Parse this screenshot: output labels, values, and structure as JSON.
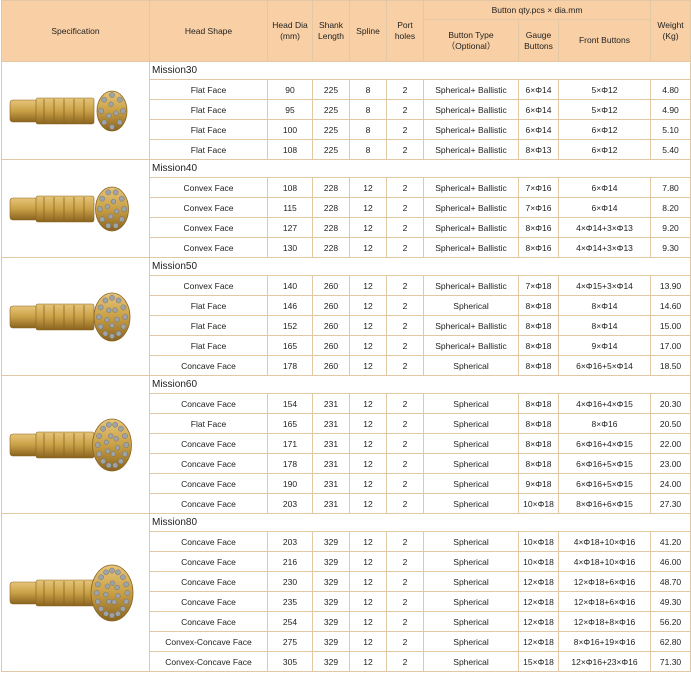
{
  "header": {
    "specification": "Specification",
    "head_shape": "Head Shape",
    "head_dia": "Head Dia (mm)",
    "shank_length": "Shank Length",
    "spline": "Spline",
    "port_holes": "Port holes",
    "button_group": "Button qty.pcs × dia.mm",
    "button_type": "Button Type",
    "button_type_optional": "（Optional）",
    "gauge_buttons": "Gauge Buttons",
    "front_buttons": "Front Buttons",
    "weight": "Weight (Kg)"
  },
  "groups": [
    {
      "name": "Mission30",
      "image": "dth-hammer-bit-flat-face",
      "rows": [
        {
          "shape": "Flat Face",
          "dia": "90",
          "shank": "225",
          "spline": "8",
          "ports": "2",
          "type": "Spherical+ Ballistic",
          "gauge": "6×Φ14",
          "front": "5×Φ12",
          "weight": "4.80"
        },
        {
          "shape": "Flat Face",
          "dia": "95",
          "shank": "225",
          "spline": "8",
          "ports": "2",
          "type": "Spherical+ Ballistic",
          "gauge": "6×Φ14",
          "front": "5×Φ12",
          "weight": "4.90"
        },
        {
          "shape": "Flat Face",
          "dia": "100",
          "shank": "225",
          "spline": "8",
          "ports": "2",
          "type": "Spherical+ Ballistic",
          "gauge": "6×Φ14",
          "front": "6×Φ12",
          "weight": "5.10"
        },
        {
          "shape": "Flat Face",
          "dia": "108",
          "shank": "225",
          "spline": "8",
          "ports": "2",
          "type": "Spherical+ Ballistic",
          "gauge": "8×Φ13",
          "front": "6×Φ12",
          "weight": "5.40"
        }
      ]
    },
    {
      "name": "Mission40",
      "image": "dth-hammer-bit-convex-face",
      "rows": [
        {
          "shape": "Convex Face",
          "dia": "108",
          "shank": "228",
          "spline": "12",
          "ports": "2",
          "type": "Spherical+ Ballistic",
          "gauge": "7×Φ16",
          "front": "6×Φ14",
          "weight": "7.80"
        },
        {
          "shape": "Convex Face",
          "dia": "115",
          "shank": "228",
          "spline": "12",
          "ports": "2",
          "type": "Spherical+ Ballistic",
          "gauge": "7×Φ16",
          "front": "6×Φ14",
          "weight": "8.20"
        },
        {
          "shape": "Convex Face",
          "dia": "127",
          "shank": "228",
          "spline": "12",
          "ports": "2",
          "type": "Spherical+ Ballistic",
          "gauge": "8×Φ16",
          "front": "4×Φ14+3×Φ13",
          "weight": "9.20"
        },
        {
          "shape": "Convex Face",
          "dia": "130",
          "shank": "228",
          "spline": "12",
          "ports": "2",
          "type": "Spherical+ Ballistic",
          "gauge": "8×Φ16",
          "front": "4×Φ14+3×Φ13",
          "weight": "9.30"
        }
      ]
    },
    {
      "name": "Mission50",
      "image": "dth-hammer-bit-mission50",
      "rows": [
        {
          "shape": "Convex Face",
          "dia": "140",
          "shank": "260",
          "spline": "12",
          "ports": "2",
          "type": "Spherical+ Ballistic",
          "gauge": "7×Φ18",
          "front": "4×Φ15+3×Φ14",
          "weight": "13.90"
        },
        {
          "shape": "Flat Face",
          "dia": "146",
          "shank": "260",
          "spline": "12",
          "ports": "2",
          "type": "Spherical",
          "gauge": "8×Φ18",
          "front": "8×Φ14",
          "weight": "14.60"
        },
        {
          "shape": "Flat Face",
          "dia": "152",
          "shank": "260",
          "spline": "12",
          "ports": "2",
          "type": "Spherical+ Ballistic",
          "gauge": "8×Φ18",
          "front": "8×Φ14",
          "weight": "15.00"
        },
        {
          "shape": "Flat Face",
          "dia": "165",
          "shank": "260",
          "spline": "12",
          "ports": "2",
          "type": "Spherical+ Ballistic",
          "gauge": "8×Φ18",
          "front": "9×Φ14",
          "weight": "17.00"
        },
        {
          "shape": "Concave Face",
          "dia": "178",
          "shank": "260",
          "spline": "12",
          "ports": "2",
          "type": "Spherical",
          "gauge": "8×Φ18",
          "front": "6×Φ16+5×Φ14",
          "weight": "18.50"
        }
      ]
    },
    {
      "name": "Mission60",
      "image": "dth-hammer-bit-mission60",
      "rows": [
        {
          "shape": "Concave Face",
          "dia": "154",
          "shank": "231",
          "spline": "12",
          "ports": "2",
          "type": "Spherical",
          "gauge": "8×Φ18",
          "front": "4×Φ16+4×Φ15",
          "weight": "20.30"
        },
        {
          "shape": "Flat Face",
          "dia": "165",
          "shank": "231",
          "spline": "12",
          "ports": "2",
          "type": "Spherical",
          "gauge": "8×Φ18",
          "front": "8×Φ16",
          "weight": "20.50"
        },
        {
          "shape": "Concave Face",
          "dia": "171",
          "shank": "231",
          "spline": "12",
          "ports": "2",
          "type": "Spherical",
          "gauge": "8×Φ18",
          "front": "6×Φ16+4×Φ15",
          "weight": "22.00"
        },
        {
          "shape": "Concave Face",
          "dia": "178",
          "shank": "231",
          "spline": "12",
          "ports": "2",
          "type": "Spherical",
          "gauge": "8×Φ18",
          "front": "6×Φ16+5×Φ15",
          "weight": "23.00"
        },
        {
          "shape": "Concave Face",
          "dia": "190",
          "shank": "231",
          "spline": "12",
          "ports": "2",
          "type": "Spherical",
          "gauge": "9×Φ18",
          "front": "6×Φ16+5×Φ15",
          "weight": "24.00"
        },
        {
          "shape": "Concave Face",
          "dia": "203",
          "shank": "231",
          "spline": "12",
          "ports": "2",
          "type": "Spherical",
          "gauge": "10×Φ18",
          "front": "8×Φ16+6×Φ15",
          "weight": "27.30"
        }
      ]
    },
    {
      "name": "Mission80",
      "image": "dth-hammer-bit-mission80",
      "rows": [
        {
          "shape": "Concave Face",
          "dia": "203",
          "shank": "329",
          "spline": "12",
          "ports": "2",
          "type": "Spherical",
          "gauge": "10×Φ18",
          "front": "4×Φ18+10×Φ16",
          "weight": "41.20"
        },
        {
          "shape": "Concave Face",
          "dia": "216",
          "shank": "329",
          "spline": "12",
          "ports": "2",
          "type": "Spherical",
          "gauge": "10×Φ18",
          "front": "4×Φ18+10×Φ16",
          "weight": "46.00"
        },
        {
          "shape": "Concave Face",
          "dia": "230",
          "shank": "329",
          "spline": "12",
          "ports": "2",
          "type": "Spherical",
          "gauge": "12×Φ18",
          "front": "12×Φ18+6×Φ16",
          "weight": "48.70"
        },
        {
          "shape": "Concave Face",
          "dia": "235",
          "shank": "329",
          "spline": "12",
          "ports": "2",
          "type": "Spherical",
          "gauge": "12×Φ18",
          "front": "12×Φ18+6×Φ16",
          "weight": "49.30"
        },
        {
          "shape": "Concave Face",
          "dia": "254",
          "shank": "329",
          "spline": "12",
          "ports": "2",
          "type": "Spherical",
          "gauge": "12×Φ18",
          "front": "12×Φ18+8×Φ16",
          "weight": "56.20"
        },
        {
          "shape": "Convex-Concave Face",
          "dia": "275",
          "shank": "329",
          "spline": "12",
          "ports": "2",
          "type": "Spherical",
          "gauge": "12×Φ18",
          "front": "8×Φ16+19×Φ16",
          "weight": "62.80"
        },
        {
          "shape": "Convex-Concave Face",
          "dia": "305",
          "shank": "329",
          "spline": "12",
          "ports": "2",
          "type": "Spherical",
          "gauge": "15×Φ18",
          "front": "12×Φ16+23×Φ16",
          "weight": "71.30"
        }
      ]
    }
  ],
  "colors": {
    "header_bg": "#f9d0a5",
    "border": "#e2c8a4",
    "bit_body": "#c9a046",
    "bit_dark": "#8a6420",
    "bit_light": "#e6c57a",
    "button_carbide": "#9ea3a8"
  }
}
